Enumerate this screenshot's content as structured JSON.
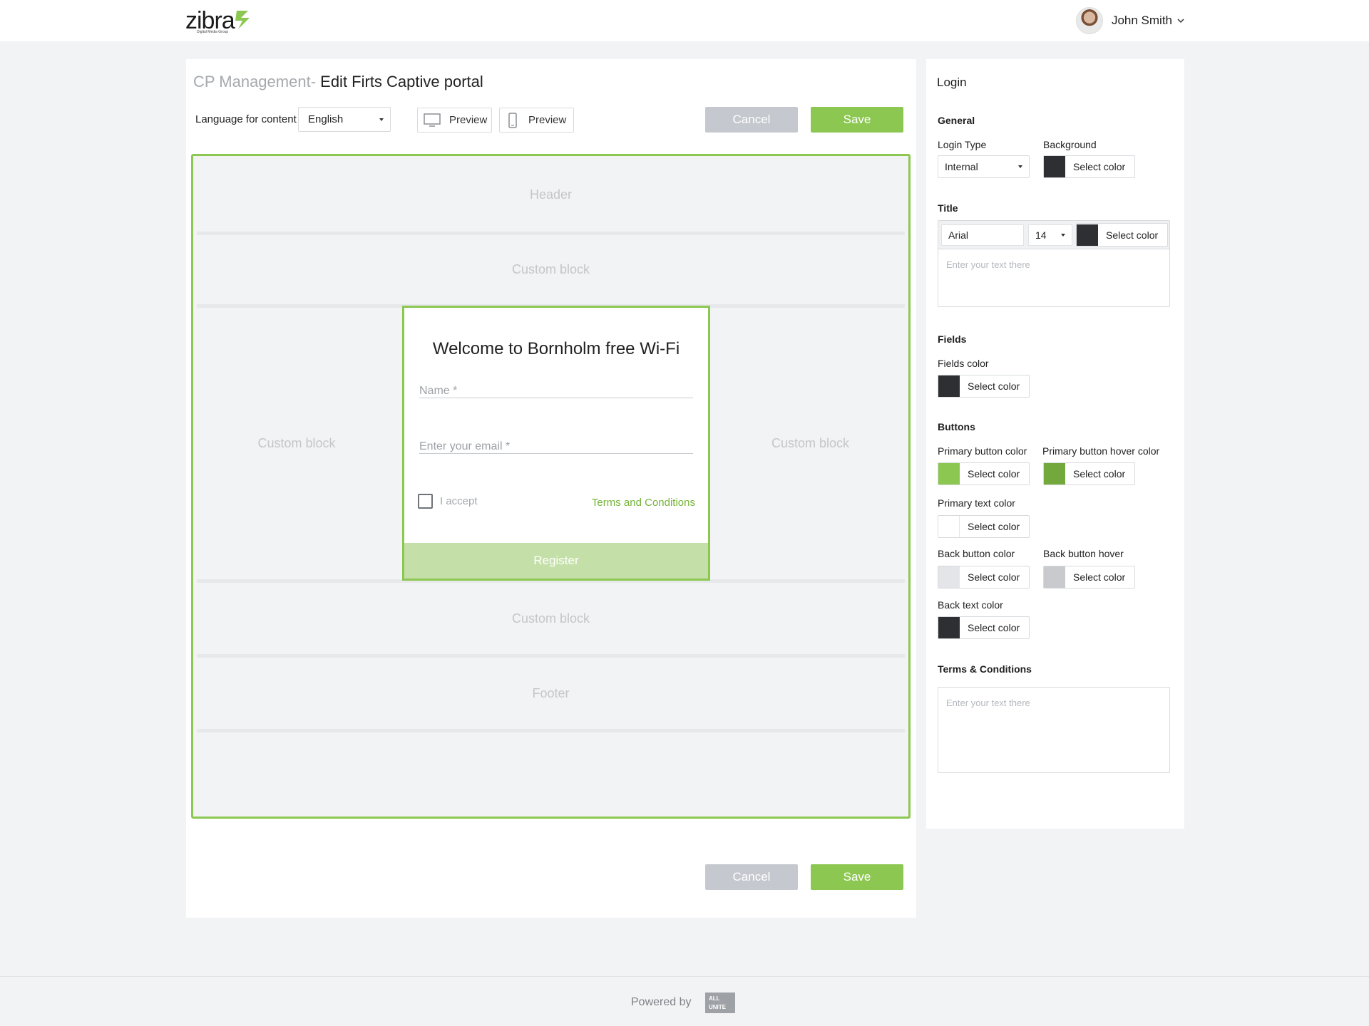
{
  "header": {
    "logo": {
      "text": "zibra",
      "subtitle": "Digital Media Group",
      "mark_color": "#8cc751"
    },
    "user": {
      "name": "John Smith"
    }
  },
  "page": {
    "breadcrumb": "CP Management-",
    "title": "Edit Firts Captive portal",
    "language_label": "Language for content",
    "language_value": "English",
    "preview_desktop": "Preview",
    "preview_mobile": "Preview",
    "cancel_label": "Cancel",
    "save_label": "Save"
  },
  "canvas": {
    "header_label": "Header",
    "custom_top": "Custom block",
    "custom_left": "Custom block",
    "custom_right": "Custom block",
    "custom_bottom": "Custom block",
    "footer_label": "Footer",
    "login": {
      "welcome": "Welcome to Bornholm free Wi-Fi",
      "name_placeholder": "Name *",
      "email_placeholder": "Enter your email *",
      "accept_label": "I accept",
      "terms_link": "Terms and Conditions",
      "register_label": "Register"
    }
  },
  "settings": {
    "panel_title": "Login",
    "general": {
      "heading": "General",
      "login_type_label": "Login Type",
      "login_type_value": "Internal",
      "background_label": "Background",
      "background_color": "#2d2f33"
    },
    "title": {
      "heading": "Title",
      "font": "Arial",
      "size": "14",
      "color": "#2d2f33",
      "text_placeholder": "Enter your text there"
    },
    "fields": {
      "heading": "Fields",
      "fields_color_label": "Fields color",
      "fields_color": "#2d2f33"
    },
    "buttons": {
      "heading": "Buttons",
      "primary_label": "Primary button color",
      "primary_color": "#8cc751",
      "primary_hover_label": "Primary button hover color",
      "primary_hover_color": "#73a83d",
      "primary_text_label": "Primary text color",
      "primary_text_color": "#ffffff",
      "back_label": "Back button color",
      "back_color": "#e4e5e8",
      "back_hover_label": "Back button hover",
      "back_hover_color": "#c8cacd",
      "back_text_label": "Back text color",
      "back_text_color": "#2d2f33"
    },
    "terms": {
      "heading": "Terms & Conditions",
      "text_placeholder": "Enter your text there"
    },
    "select_color_label": "Select color"
  },
  "footer": {
    "powered_by": "Powered by",
    "brand_line1": "ALL",
    "brand_line2": "UNITE"
  }
}
